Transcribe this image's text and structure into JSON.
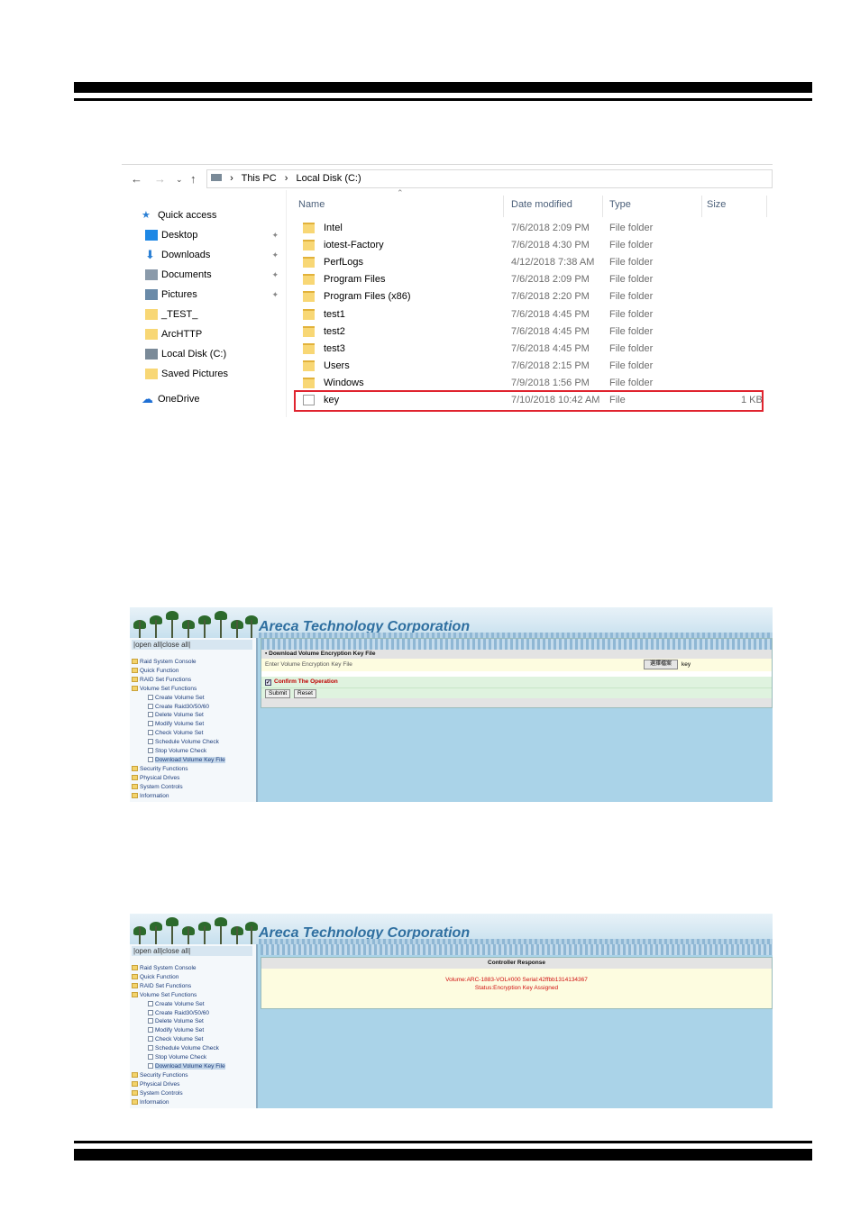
{
  "explorer": {
    "address": [
      "This PC",
      "Local Disk (C:)"
    ],
    "columns": {
      "name": "Name",
      "date": "Date modified",
      "type": "Type",
      "size": "Size"
    },
    "sidebar": [
      {
        "label": "Quick access",
        "icon": "star-icon"
      },
      {
        "label": "Desktop",
        "icon": "desktop-icon",
        "pinned": true
      },
      {
        "label": "Downloads",
        "icon": "download-arrow-icon",
        "pinned": true
      },
      {
        "label": "Documents",
        "icon": "document-icon",
        "pinned": true
      },
      {
        "label": "Pictures",
        "icon": "pictures-icon",
        "pinned": true
      },
      {
        "label": "_TEST_",
        "icon": "folder-icon"
      },
      {
        "label": "ArcHTTP",
        "icon": "folder-icon"
      },
      {
        "label": "Local Disk (C:)",
        "icon": "drive-icon"
      },
      {
        "label": "Saved Pictures",
        "icon": "folder-icon"
      },
      {
        "label": "OneDrive",
        "icon": "cloud-icon"
      }
    ],
    "files": [
      {
        "name": "Intel",
        "date": "7/6/2018 2:09 PM",
        "type": "File folder",
        "size": ""
      },
      {
        "name": "iotest-Factory",
        "date": "7/6/2018 4:30 PM",
        "type": "File folder",
        "size": ""
      },
      {
        "name": "PerfLogs",
        "date": "4/12/2018 7:38 AM",
        "type": "File folder",
        "size": ""
      },
      {
        "name": "Program Files",
        "date": "7/6/2018 2:09 PM",
        "type": "File folder",
        "size": ""
      },
      {
        "name": "Program Files (x86)",
        "date": "7/6/2018 2:20 PM",
        "type": "File folder",
        "size": ""
      },
      {
        "name": "test1",
        "date": "7/6/2018 4:45 PM",
        "type": "File folder",
        "size": ""
      },
      {
        "name": "test2",
        "date": "7/6/2018 4:45 PM",
        "type": "File folder",
        "size": ""
      },
      {
        "name": "test3",
        "date": "7/6/2018 4:45 PM",
        "type": "File folder",
        "size": ""
      },
      {
        "name": "Users",
        "date": "7/6/2018 2:15 PM",
        "type": "File folder",
        "size": ""
      },
      {
        "name": "Windows",
        "date": "7/9/2018 1:56 PM",
        "type": "File folder",
        "size": ""
      },
      {
        "name": "key",
        "date": "7/10/2018 10:42 AM",
        "type": "File",
        "size": "1 KB"
      }
    ],
    "highlight_color": "#e0242f"
  },
  "areca": {
    "title": "Areca Technology Corporation",
    "openall": "|open all|close all|",
    "tree": [
      {
        "label": "Raid System Console",
        "kind": "root"
      },
      {
        "label": "Quick Function",
        "kind": "folder"
      },
      {
        "label": "RAID Set Functions",
        "kind": "folder"
      },
      {
        "label": "Volume Set Functions",
        "kind": "folder"
      },
      {
        "label": "Create Volume Set",
        "kind": "doc"
      },
      {
        "label": "Create Raid30/50/60",
        "kind": "doc"
      },
      {
        "label": "Delete Volume Set",
        "kind": "doc"
      },
      {
        "label": "Modify Volume Set",
        "kind": "doc"
      },
      {
        "label": "Check Volume Set",
        "kind": "doc"
      },
      {
        "label": "Schedule Volume Check",
        "kind": "doc"
      },
      {
        "label": "Stop Volume Check",
        "kind": "doc"
      },
      {
        "label": "Download Volume Key File",
        "kind": "doc",
        "selected": true
      },
      {
        "label": "Security Functions",
        "kind": "folder"
      },
      {
        "label": "Physical Drives",
        "kind": "folder"
      },
      {
        "label": "System Controls",
        "kind": "folder"
      },
      {
        "label": "Information",
        "kind": "folder"
      }
    ],
    "form": {
      "header": "Download Volume Encryption Key File",
      "field_label": "Enter Volume Encryption Key File",
      "browse_label": "選擇檔案",
      "file_value": "key",
      "confirm_label": "Confirm The Operation",
      "submit_label": "Submit",
      "reset_label": "Reset"
    },
    "response": {
      "header": "Controller Response",
      "line1": "Volume:ARC-1883-VOL#000 Serial:42ffbb1314134367",
      "line2": "Status:Encryption Key Assigned"
    }
  }
}
